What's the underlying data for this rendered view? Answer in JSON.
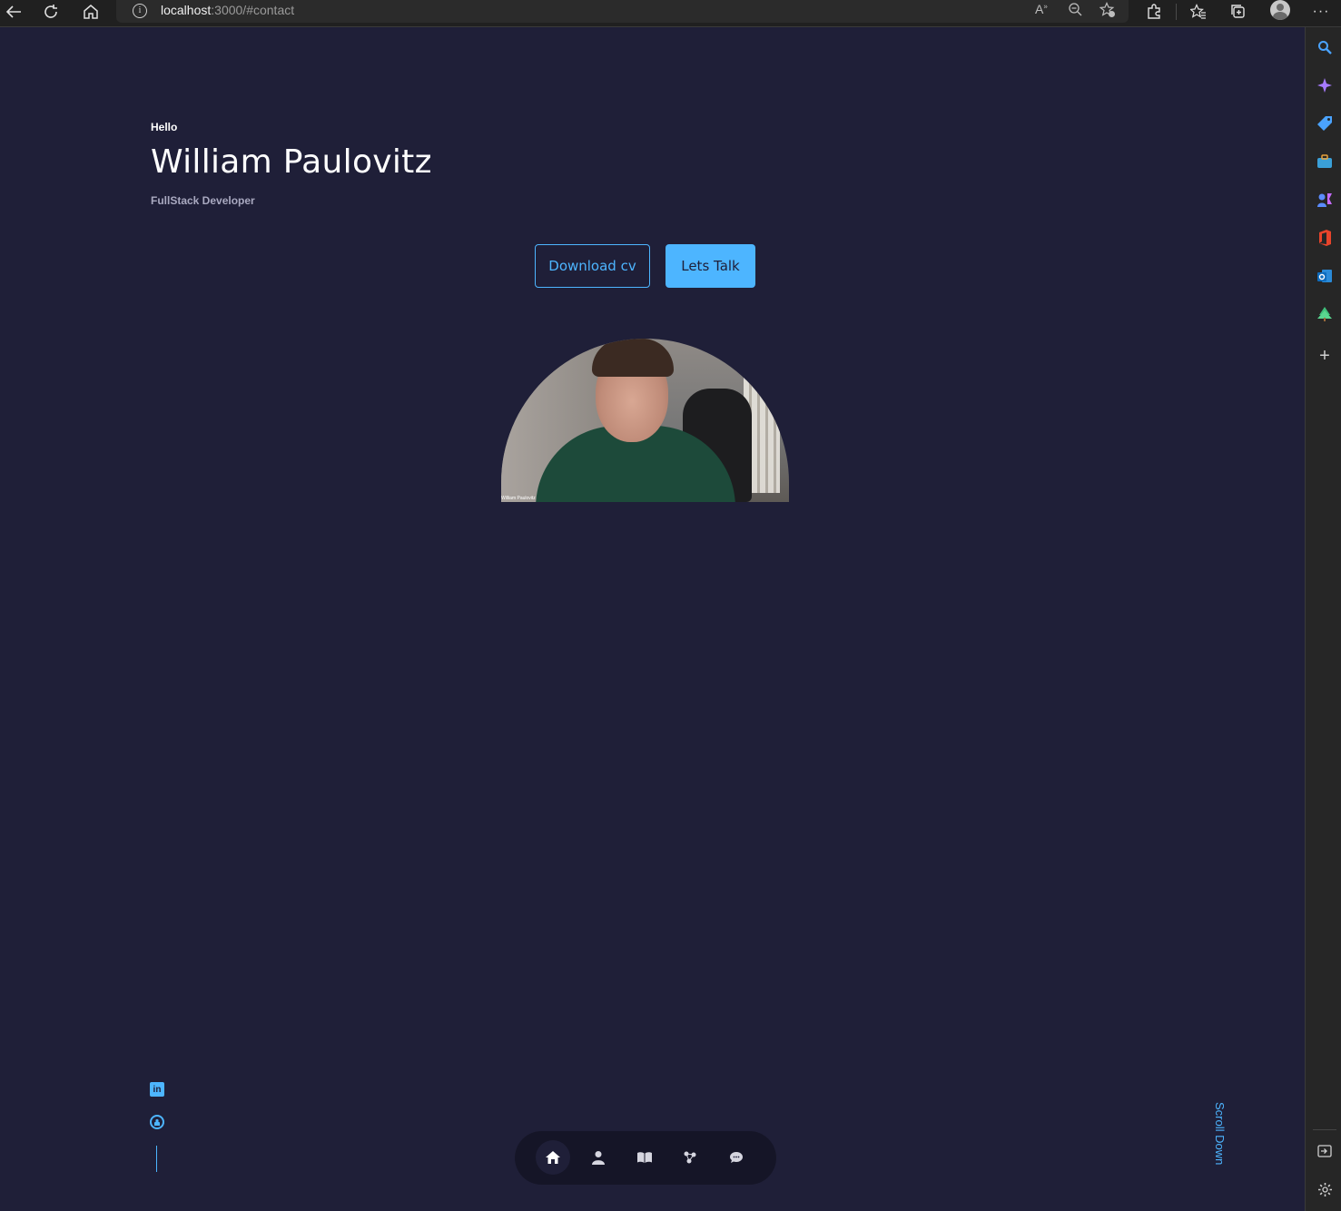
{
  "browser": {
    "url_host": "localhost",
    "url_rest": ":3000/#contact"
  },
  "hero": {
    "greeting": "Hello",
    "name": "William Paulovitz",
    "role": "FullStack Developer",
    "download_label": "Download cv",
    "talk_label": "Lets Talk",
    "photo_caption": "William Paulovitz"
  },
  "scroll_label": "Scroll Down",
  "socials": {
    "linkedin_icon": "linkedin-icon",
    "github_icon": "github-icon"
  },
  "nav": {
    "items": [
      {
        "icon": "home-icon",
        "active": true
      },
      {
        "icon": "user-icon",
        "active": false
      },
      {
        "icon": "book-icon",
        "active": false
      },
      {
        "icon": "services-icon",
        "active": false
      },
      {
        "icon": "message-icon",
        "active": false
      }
    ]
  },
  "colors": {
    "background": "#1f1f38",
    "accent": "#4db5ff"
  }
}
